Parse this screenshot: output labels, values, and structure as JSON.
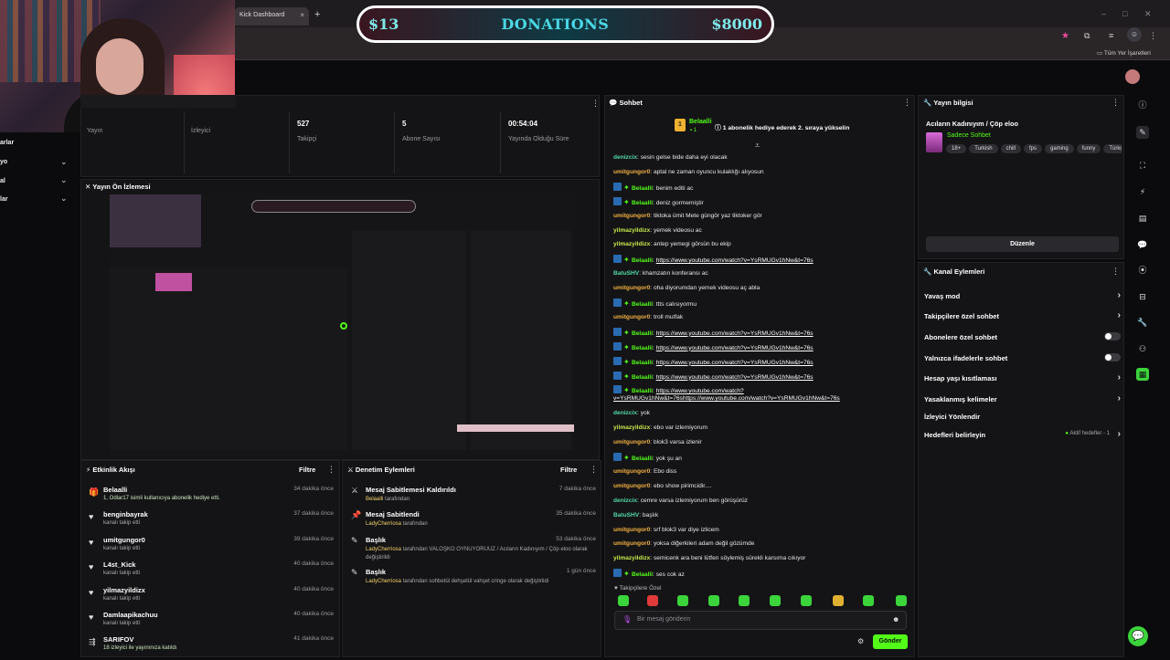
{
  "browser": {
    "tab_title": "Kick Dashboard",
    "bookmarks_label": "Tüm Yer İşaretleri"
  },
  "donation": {
    "left_value": "$13",
    "title": "DONATIONS",
    "right_value": "$8000"
  },
  "leftnav": {
    "items": [
      "arlar",
      "yo",
      "al",
      "lar"
    ]
  },
  "stats": [
    {
      "value": "",
      "label": "Yayın"
    },
    {
      "value": "",
      "label": "İzleyici"
    },
    {
      "value": "527",
      "label": "Takipçi"
    },
    {
      "value": "5",
      "label": "Abone Sayısı"
    },
    {
      "value": "00:54:04",
      "label": "Yayında Olduğu Süre"
    }
  ],
  "preview": {
    "title": "Yayın Ön İzlemesi"
  },
  "activity": {
    "title": "Etkinlik Akışı",
    "filter": "Filtre",
    "items": [
      {
        "name": "Belaalli",
        "sub": "1, Odlar17 isimli kullanıcıya abonelik hediye etti.",
        "time": "34 dakika önce",
        "icon": "gift-icon"
      },
      {
        "name": "benginbayrak",
        "sub": "kanalı takip etti",
        "time": "37 dakika önce",
        "icon": "heart-icon"
      },
      {
        "name": "umitgungor0",
        "sub": "kanalı takip etti",
        "time": "39 dakika önce",
        "icon": "heart-icon"
      },
      {
        "name": "L4st_Kick",
        "sub": "kanalı takip etti",
        "time": "40 dakika önce",
        "icon": "heart-icon"
      },
      {
        "name": "yilmazyildizx",
        "sub": "kanalı takip etti",
        "time": "40 dakika önce",
        "icon": "heart-icon"
      },
      {
        "name": "Damlaapikachuu",
        "sub": "kanalı takip etti",
        "time": "40 dakika önce",
        "icon": "heart-icon"
      },
      {
        "name": "SARIFOV",
        "sub": "18 izleyici ile yayınınıza katıldı",
        "time": "41 dakika önce",
        "icon": "raid-icon"
      }
    ]
  },
  "moderation": {
    "title": "Denetim Eylemleri",
    "filter": "Filtre",
    "items": [
      {
        "name": "Mesaj Sabitlemesi Kaldırıldı",
        "user": "Belaalli",
        "rest": " tarafından",
        "time": "7 dakika önce"
      },
      {
        "name": "Mesaj Sabitlendi",
        "user": "LadyCherriosa",
        "rest": " tarafından",
        "time": "35 dakika önce"
      },
      {
        "name": "Başlık",
        "user": "LadyCherriosa",
        "rest": " tarafından VALOŞKO OYNUYORUUZ / Acıların Kadınıyım / Çöp eloo olarak değiştirildi",
        "time": "53 dakika önce"
      },
      {
        "name": "Başlık",
        "user": "LadyCherriosa",
        "rest": " tarafından sohbetül dehşetül vahşet cringe olarak değiştirildi",
        "time": "1 gün önce"
      }
    ]
  },
  "chat": {
    "title": "Sohbet",
    "pinned_user": "Belaalli",
    "pinned_count": "1",
    "pinned_text": "1 abonelik hediye ederek 2. sıraya yükselin",
    "messages": [
      {
        "user": "denizcix",
        "color": "#53d8a6",
        "text": "sesin gelse bide daha eyi olacak",
        "badges": false
      },
      {
        "user": "umitgungor0",
        "color": "#f0b040",
        "text": "aptal ne zaman oyuncu kulaklığı alıyosun",
        "badges": false
      },
      {
        "user": "Belaalli",
        "color": "#53fc18",
        "text": "benim editi ac",
        "badges": true
      },
      {
        "user": "Belaalli",
        "color": "#53fc18",
        "text": "deniz gormemiştir",
        "badges": true
      },
      {
        "user": "umitgungor0",
        "color": "#f0b040",
        "text": "tiktoka ümit Mete güngör yaz tiktoker gör",
        "badges": false
      },
      {
        "user": "yilmazyildizx",
        "color": "#c8e84a",
        "text": "yemek videosu ac",
        "badges": false
      },
      {
        "user": "yilmazyildizx",
        "color": "#c8e84a",
        "text": "antep yemegi görsün bu ekip",
        "badges": false
      },
      {
        "user": "Belaalli",
        "color": "#53fc18",
        "text": "https://www.youtube.com/watch?v=YsRMUGv1hNw&t=76s",
        "badges": true,
        "link": true
      },
      {
        "user": "BatuSHV",
        "color": "#53d8a6",
        "text": "khamzatın konferansı ac",
        "badges": false
      },
      {
        "user": "umitgungor0",
        "color": "#f0b040",
        "text": "oha diyorumdan yemek videosu aç abla",
        "badges": false
      },
      {
        "user": "Belaalli",
        "color": "#53fc18",
        "text": "ttts calısıyormu",
        "badges": true
      },
      {
        "user": "umitgungor0",
        "color": "#f0b040",
        "text": "troll mutfak",
        "badges": false
      },
      {
        "user": "Belaalli",
        "color": "#53fc18",
        "text": "https://www.youtube.com/watch?v=YsRMUGv1hNw&t=76s",
        "badges": true,
        "link": true
      },
      {
        "user": "Belaalli",
        "color": "#53fc18",
        "text": "https://www.youtube.com/watch?v=YsRMUGv1hNw&t=76s",
        "badges": true,
        "link": true
      },
      {
        "user": "Belaalli",
        "color": "#53fc18",
        "text": "https://www.youtube.com/watch?v=YsRMUGv1hNw&t=76s",
        "badges": true,
        "link": true
      },
      {
        "user": "Belaalli",
        "color": "#53fc18",
        "text": "https://www.youtube.com/watch?v=YsRMUGv1hNw&t=76s",
        "badges": true,
        "link": true
      },
      {
        "user": "Belaalli",
        "color": "#53fc18",
        "text": "https://www.youtube.com/watch?",
        "badges": true,
        "link": true,
        "cont": "v=YsRMUGv1hNw&t=76shttps://www.youtube.com/watch?v=YsRMUGv1hNw&t=76s"
      },
      {
        "user": "denizcix",
        "color": "#53d8a6",
        "text": "yok",
        "badges": false
      },
      {
        "user": "yilmazyildizx",
        "color": "#c8e84a",
        "text": "ebo var izlemiyorum",
        "badges": false
      },
      {
        "user": "umitgungor0",
        "color": "#f0b040",
        "text": "blok3 varsa izlenir",
        "badges": false
      },
      {
        "user": "Belaalli",
        "color": "#53fc18",
        "text": "yok şu an",
        "badges": true
      },
      {
        "user": "umitgungor0",
        "color": "#f0b040",
        "text": "Ebo diss",
        "badges": false
      },
      {
        "user": "umitgungor0",
        "color": "#f0b040",
        "text": "ebo show pirimcidir....",
        "badges": false
      },
      {
        "user": "denizcix",
        "color": "#53d8a6",
        "text": "cemre varsa izlemiyorum ben görüşürüz",
        "badges": false
      },
      {
        "user": "BatuSHV",
        "color": "#53d8a6",
        "text": "başlık",
        "badges": false
      },
      {
        "user": "umitgungor0",
        "color": "#f0b040",
        "text": "srf blok3 var diye izlicem",
        "badges": false
      },
      {
        "user": "umitgungor0",
        "color": "#f0b040",
        "text": "yoksa diğerkileri adam değil gözümde",
        "badges": false
      },
      {
        "user": "yilmazyildizx",
        "color": "#c8e84a",
        "text": "semicenk ara beni lütfen söylemiş sürekli karsıma cıkıyor",
        "badges": false
      },
      {
        "user": "Belaalli",
        "color": "#53fc18",
        "text": "ses cok az",
        "badges": true
      }
    ],
    "followers_only": "Takipçilere Özel",
    "input_placeholder": "Bir mesaj gönderin",
    "send": "Gönder"
  },
  "stream_info": {
    "title": "Yayın bilgisi",
    "stream_title": "Acıların Kadınıyım / Çöp eloo",
    "category": "Sadece Sohbet",
    "tags": [
      "18+",
      "Turkish",
      "chill",
      "fps",
      "gaming",
      "funny",
      "Türkçe"
    ],
    "edit": "Düzenle"
  },
  "channel_actions": {
    "title": "Kanal Eylemleri",
    "items": [
      {
        "label": "Yavaş mod",
        "control": "chevron"
      },
      {
        "label": "Takipçilere özel sohbet",
        "control": "chevron"
      },
      {
        "label": "Abonelere özel sohbet",
        "control": "toggle"
      },
      {
        "label": "Yalnızca ifadelerle sohbet",
        "control": "toggle"
      },
      {
        "label": "Hesap yaşı kısıtlaması",
        "control": "chevron"
      },
      {
        "label": "Yasaklanmış kelimeler",
        "control": "chevron"
      },
      {
        "label": "İzleyici Yönlendir",
        "control": "none"
      },
      {
        "label": "Hedefleri belirleyin",
        "control": "chevron",
        "extra": "Aktif hedefler - 1"
      }
    ]
  },
  "colors": {
    "accent": "#53fc18",
    "panel": "#141416",
    "bg": "#0b0b0d"
  }
}
